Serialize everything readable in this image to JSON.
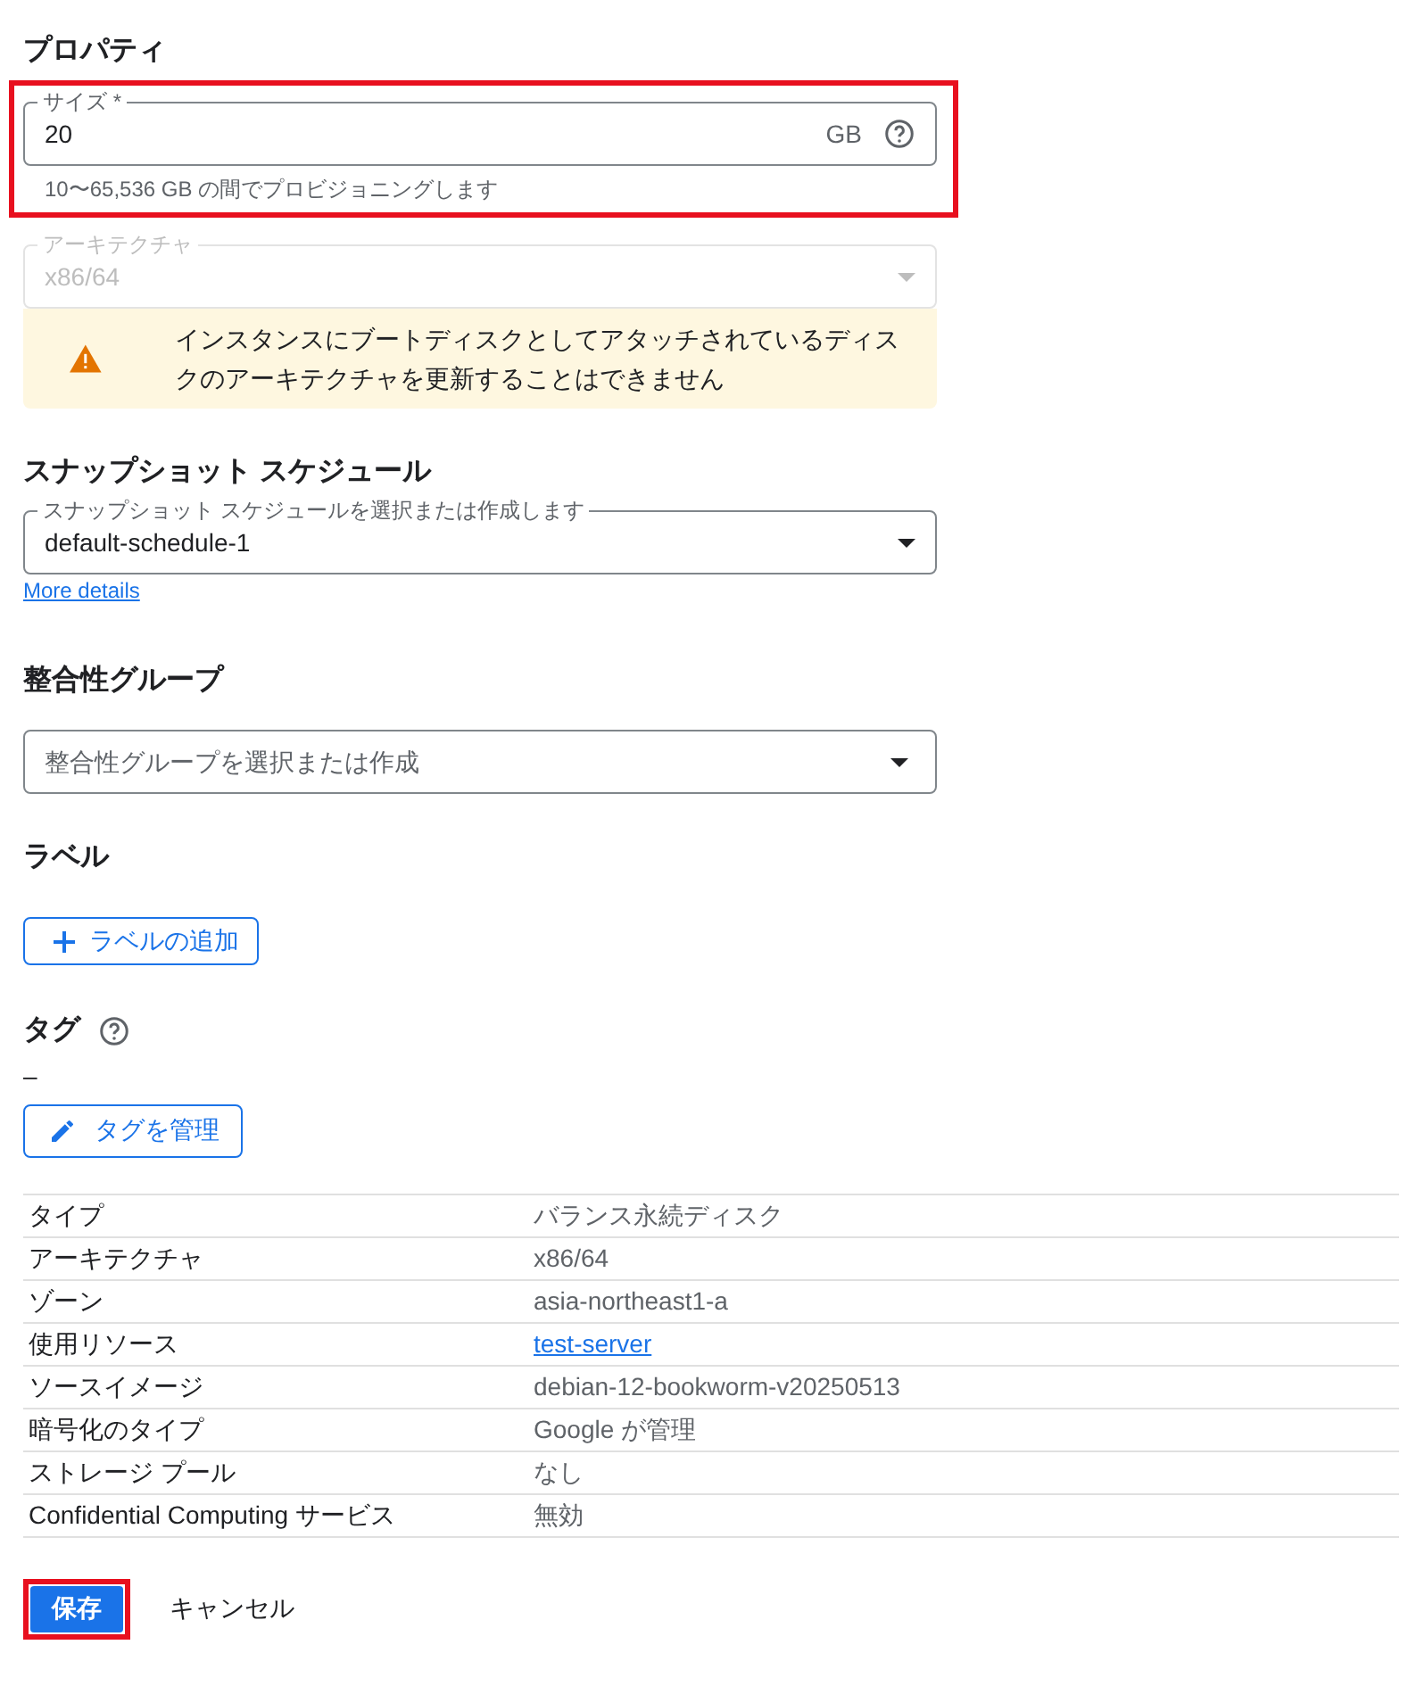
{
  "section_title": "プロパティ",
  "size_field": {
    "label": "サイズ *",
    "value": "20",
    "unit": "GB",
    "hint": "10〜65,536 GB の間でプロビジョニングします",
    "highlighted": true
  },
  "architecture_field": {
    "label": "アーキテクチャ",
    "value": "x86/64",
    "disabled": true
  },
  "warning": {
    "text": "インスタンスにブートディスクとしてアタッチされているディスクのアーキテクチャを更新することはできません"
  },
  "snapshot_section": {
    "title": "スナップショット スケジュール",
    "field": {
      "label": "スナップショット スケジュールを選択または作成します",
      "value": "default-schedule-1"
    },
    "link": "More details"
  },
  "consistency_section": {
    "title": "整合性グループ",
    "field": {
      "placeholder": "整合性グループを選択または作成"
    }
  },
  "labels_section": {
    "title": "ラベル",
    "button": "ラベルの追加"
  },
  "tags_section": {
    "title": "タグ",
    "value": "–",
    "button": "タグを管理"
  },
  "details_table": {
    "rows": [
      {
        "key": "タイプ",
        "value": "バランス永続ディスク",
        "kind": "text"
      },
      {
        "key": "アーキテクチャ",
        "value": "x86/64",
        "kind": "text"
      },
      {
        "key": "ゾーン",
        "value": "asia-northeast1-a",
        "kind": "text"
      },
      {
        "key": "使用リソース",
        "value": "test-server",
        "kind": "link"
      },
      {
        "key": "ソースイメージ",
        "value": "debian-12-bookworm-v20250513",
        "kind": "text"
      },
      {
        "key": "暗号化のタイプ",
        "value": "Google が管理",
        "kind": "text"
      },
      {
        "key": "ストレージ プール",
        "value": "なし",
        "kind": "text"
      },
      {
        "key": "Confidential Computing サービス",
        "value": "無効",
        "kind": "text"
      }
    ]
  },
  "actions": {
    "save": {
      "label": "保存",
      "highlighted": true
    },
    "cancel": "キャンセル"
  }
}
